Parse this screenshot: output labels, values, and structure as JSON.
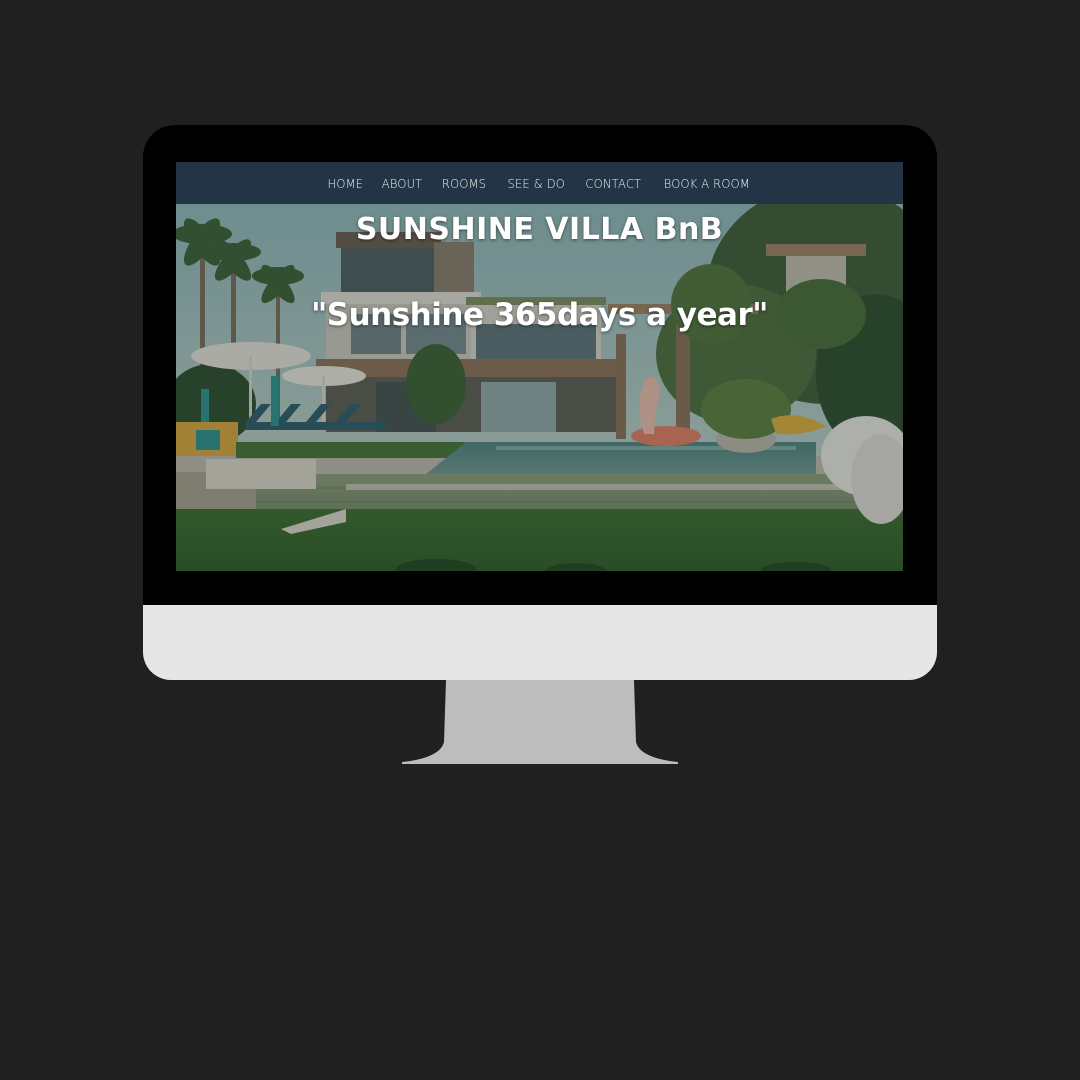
{
  "site": {
    "title": "SUNSHINE VILLA BnB",
    "tagline": "\"Sunshine 365days a year\""
  },
  "nav": {
    "items": [
      {
        "label": "HOME"
      },
      {
        "label": "ABOUT"
      },
      {
        "label": "ROOMS"
      },
      {
        "label": "SEE & DO"
      },
      {
        "label": "CONTACT"
      },
      {
        "label": "BOOK A ROOM"
      }
    ]
  },
  "colors": {
    "page_background": "#202020",
    "navbar": "#223446",
    "bezel": "#000000",
    "chin": "#e6e6e6",
    "stand": "#bdbdbd",
    "text": "#ffffff"
  },
  "hero_image": {
    "depicts": "villa-with-pool-palm-trees-and-lawn"
  }
}
